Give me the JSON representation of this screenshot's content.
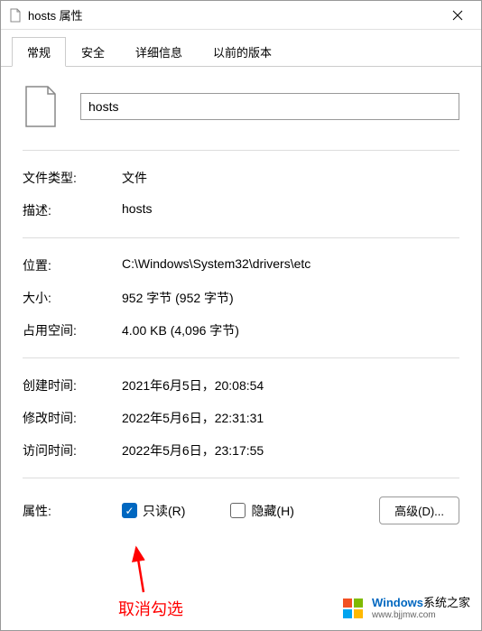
{
  "titlebar": {
    "title": "hosts 属性"
  },
  "tabs": [
    {
      "label": "常规",
      "active": true
    },
    {
      "label": "安全",
      "active": false
    },
    {
      "label": "详细信息",
      "active": false
    },
    {
      "label": "以前的版本",
      "active": false
    }
  ],
  "filename": "hosts",
  "properties": {
    "type_label": "文件类型:",
    "type_value": "文件",
    "desc_label": "描述:",
    "desc_value": "hosts",
    "location_label": "位置:",
    "location_value": "C:\\Windows\\System32\\drivers\\etc",
    "size_label": "大小:",
    "size_value": "952 字节 (952 字节)",
    "disk_label": "占用空间:",
    "disk_value": "4.00 KB (4,096 字节)",
    "created_label": "创建时间:",
    "created_value": "2021年6月5日，20:08:54",
    "modified_label": "修改时间:",
    "modified_value": "2022年5月6日，22:31:31",
    "accessed_label": "访问时间:",
    "accessed_value": "2022年5月6日，23:17:55",
    "attr_label": "属性:",
    "readonly_label": "只读(R)",
    "readonly_checked": true,
    "hidden_label": "隐藏(H)",
    "hidden_checked": false,
    "advanced_label": "高级(D)..."
  },
  "annotation": {
    "text": "取消勾选"
  },
  "watermark": {
    "brand_prefix": "Windows",
    "brand_suffix": "系统之家",
    "url": "www.bjjmw.com"
  }
}
